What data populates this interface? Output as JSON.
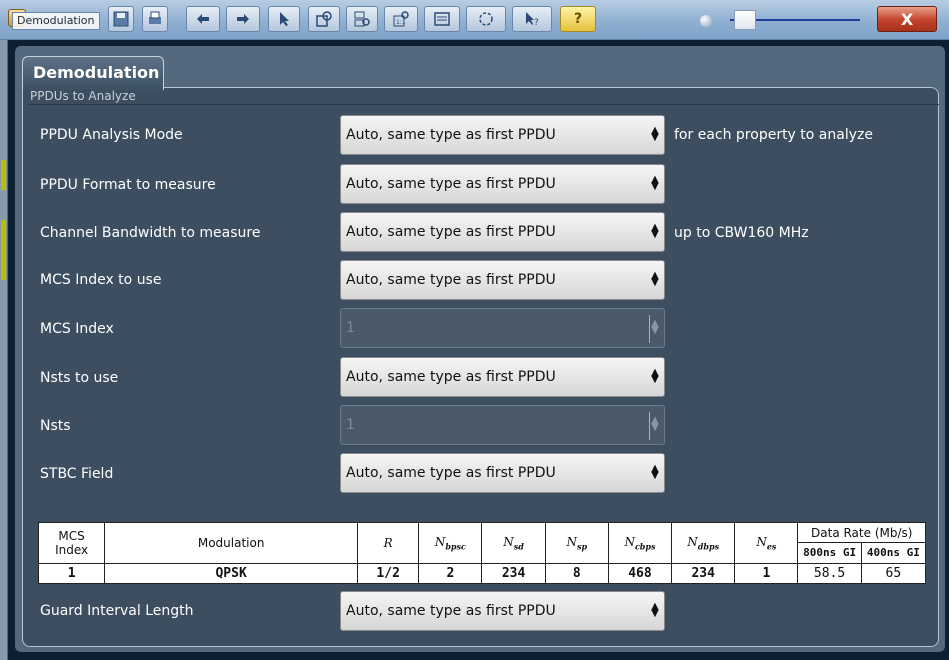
{
  "window": {
    "title": "Demodulation",
    "close_label": "X"
  },
  "toolbar": {
    "items": [
      "save-icon",
      "print-icon",
      "undo-icon",
      "redo-icon",
      "pointer-icon",
      "zoom-icon",
      "multi-zoom-icon",
      "zoom-off-icon",
      "display-icon",
      "network-icon",
      "help-pointer-icon",
      "help-icon"
    ],
    "help_label": "?"
  },
  "dialog": {
    "tab_label": "Demodulation",
    "group_title": "PPDUs to Analyze"
  },
  "fields": {
    "analysis_mode": {
      "label": "PPDU Analysis Mode",
      "value": "Auto, same type as first PPDU",
      "note": "for each property to analyze"
    },
    "format": {
      "label": "PPDU Format to measure",
      "value": "Auto, same type as first PPDU"
    },
    "bandwidth": {
      "label": "Channel Bandwidth to measure",
      "value": "Auto, same type as first PPDU",
      "note": "up to CBW160 MHz"
    },
    "mcs_use": {
      "label": "MCS Index to use",
      "value": "Auto, same type as first PPDU"
    },
    "mcs_index": {
      "label": "MCS Index",
      "value": "1"
    },
    "nsts_use": {
      "label": "Nsts to use",
      "value": "Auto, same type as first PPDU"
    },
    "nsts": {
      "label": "Nsts",
      "value": "1"
    },
    "stbc": {
      "label": "STBC Field",
      "value": "Auto, same type as first PPDU"
    },
    "guard": {
      "label": "Guard Interval Length",
      "value": "Auto, same type as first PPDU"
    }
  },
  "table": {
    "mcs_index_header_line1": "MCS",
    "mcs_index_header_line2": "Index",
    "modulation_header": "Modulation",
    "r_header": "R",
    "sym_N": "N",
    "nbpsc_sub": "bpsc",
    "nsd_sub": "sd",
    "nsp_sub": "sp",
    "ncbps_sub": "cbps",
    "ndbps_sub": "dbps",
    "nes_sub": "es",
    "data_rate_header": "Data Rate (Mb/s)",
    "gi800_header": "800ns GI",
    "gi400_header": "400ns GI",
    "row": {
      "mcs_index": "1",
      "modulation": "QPSK",
      "r": "1/2",
      "nbpsc": "2",
      "nsd": "234",
      "nsp": "8",
      "ncbps": "468",
      "ndbps": "234",
      "nes": "1",
      "rate_800": "58.5",
      "rate_400": "65"
    }
  },
  "colors": {
    "panel_bg": "#3c4e60",
    "dropdown_bg": "#e6e6e6",
    "close_red": "#c2432a"
  }
}
